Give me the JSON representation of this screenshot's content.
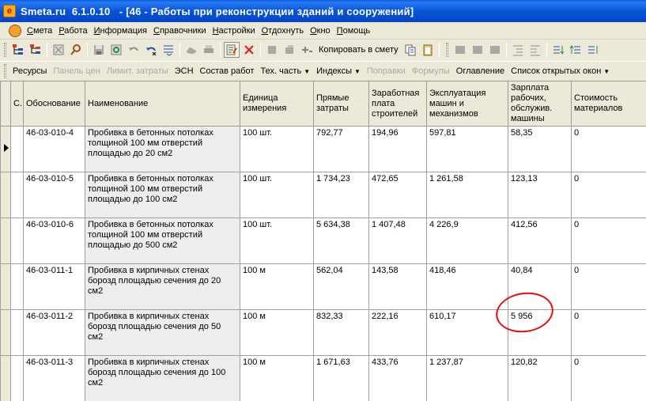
{
  "window": {
    "title": "Smeta.ru  6.1.0.10   - [46 - Работы при реконструкции зданий и сооружений]"
  },
  "menu": [
    "Смета",
    "Работа",
    "Информация",
    "Справочники",
    "Настройки",
    "Отдохнуть",
    "Окно",
    "Помощь"
  ],
  "toolbar1": {
    "copy_label": "Копировать в смету"
  },
  "toolbar2": {
    "items": [
      {
        "label": "Ресурсы",
        "disabled": false,
        "dropdown": false
      },
      {
        "label": "Панель цен",
        "disabled": true,
        "dropdown": false
      },
      {
        "label": "Лимит. затраты",
        "disabled": true,
        "dropdown": false
      },
      {
        "label": "ЭСН",
        "disabled": false,
        "dropdown": false
      },
      {
        "label": "Состав работ",
        "disabled": false,
        "dropdown": false
      },
      {
        "label": "Тех. часть",
        "disabled": false,
        "dropdown": true
      },
      {
        "label": "Индексы",
        "disabled": false,
        "dropdown": true
      },
      {
        "label": "Поправки",
        "disabled": true,
        "dropdown": false
      },
      {
        "label": "Формулы",
        "disabled": true,
        "dropdown": false
      },
      {
        "label": "Оглавление",
        "disabled": false,
        "dropdown": false
      },
      {
        "label": "Список открытых окон",
        "disabled": false,
        "dropdown": true
      }
    ]
  },
  "table": {
    "columns": [
      "С.",
      "Обоснование",
      "Наименование",
      "Единица измерения",
      "Прямые затраты",
      "Заработная плата строителей",
      "Эксплуатация машин и механизмов",
      "Зарплата рабочих, обслужив. машины",
      "Стоимость материалов"
    ],
    "rows": [
      [
        "46-03-010-4",
        "Пробивка в бетонных потолках толщиной 100 мм отверстий площадью до 20 см2",
        "100 шт.",
        "792,77",
        "194,96",
        "597,81",
        "58,35",
        "0"
      ],
      [
        "46-03-010-5",
        "Пробивка в бетонных потолках толщиной 100 мм отверстий площадью до 100 см2",
        "100 шт.",
        "1 734,23",
        "472,65",
        "1 261,58",
        "123,13",
        "0"
      ],
      [
        "46-03-010-6",
        "Пробивка в бетонных потолках толщиной 100 мм отверстий площадью до 500 см2",
        "100 шт.",
        "5 634,38",
        "1 407,48",
        "4 226,9",
        "412,56",
        "0"
      ],
      [
        "46-03-011-1",
        "Пробивка в кирпичных стенах борозд площадью сечения до 20 см2",
        "100 м",
        "562,04",
        "143,58",
        "418,46",
        "40,84",
        "0"
      ],
      [
        "46-03-011-2",
        "Пробивка в кирпичных стенах борозд площадью сечения до 50 см2",
        "100 м",
        "832,33",
        "222,16",
        "610,17",
        "5 956",
        "0"
      ],
      [
        "46-03-011-3",
        "Пробивка в кирпичных стенах борозд площадью сечения до 100 см2",
        "100 м",
        "1 671,63",
        "433,76",
        "1 237,87",
        "120,82",
        "0"
      ]
    ],
    "current_row": 0
  },
  "colors": {
    "title_bar": "#0753D8",
    "annotation": "#E01010"
  }
}
